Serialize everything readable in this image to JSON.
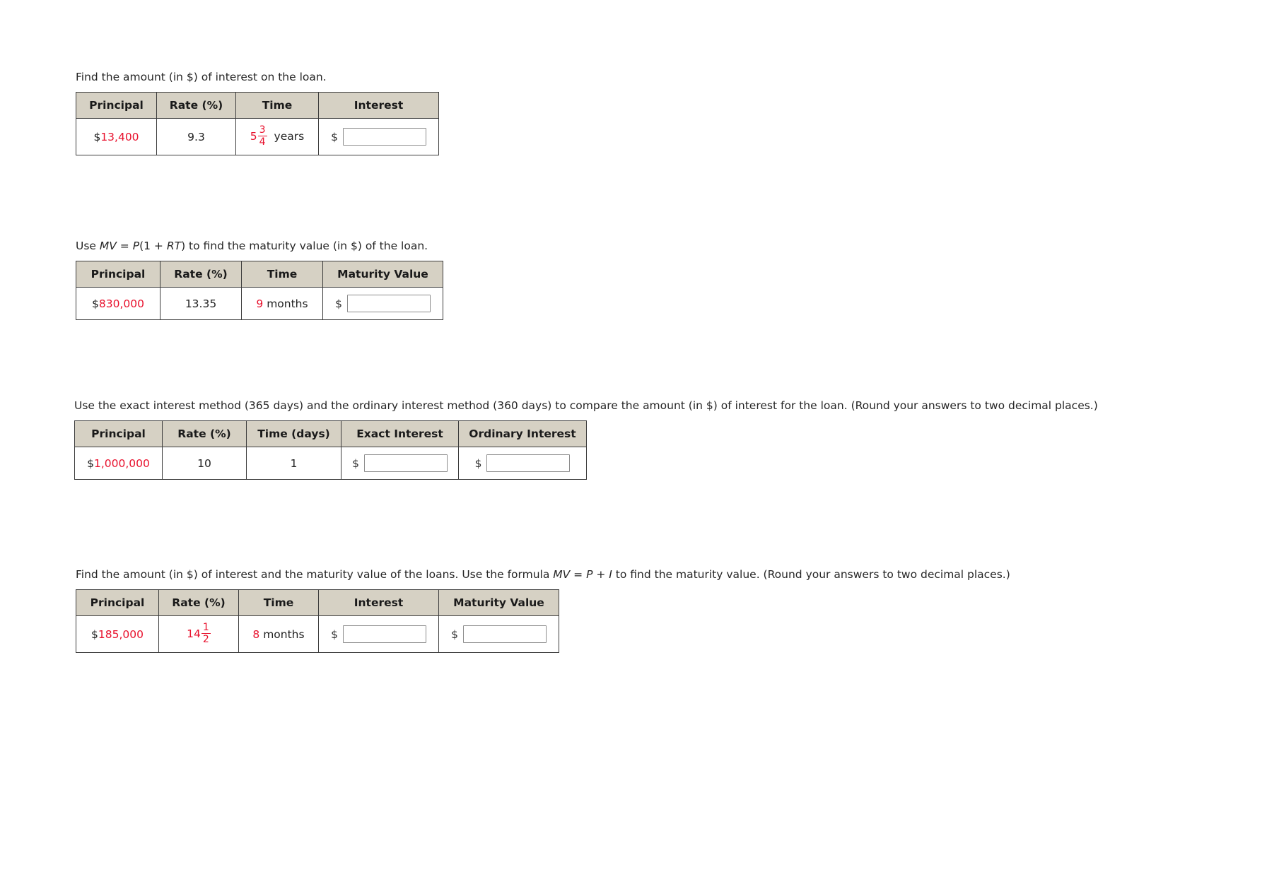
{
  "colors": {
    "highlight": "#e8112d",
    "header_bg": "#d6d1c4",
    "border": "#3c3c3c",
    "text": "#262626"
  },
  "problems": [
    {
      "id": "interest-on-loan",
      "prompt": {
        "parts": [
          {
            "text": "Find the amount (in $) of interest on the loan.",
            "italic": false
          }
        ]
      },
      "headers": [
        "Principal",
        "Rate (%)",
        "Time",
        "Interest"
      ],
      "row": {
        "principal": {
          "symbol": "$",
          "value": "13,400"
        },
        "rate": "9.3",
        "time": {
          "whole": "5",
          "numerator": "3",
          "denominator": "4",
          "unit": "years"
        },
        "answers": [
          {
            "label": "Interest",
            "prefix": "$",
            "value": "",
            "placeholder": ""
          }
        ]
      }
    },
    {
      "id": "maturity-value",
      "prompt": {
        "parts": [
          {
            "text": "Use ",
            "italic": false
          },
          {
            "text": "MV",
            "italic": true
          },
          {
            "text": " = ",
            "italic": false
          },
          {
            "text": "P",
            "italic": true
          },
          {
            "text": "(1 + ",
            "italic": false
          },
          {
            "text": "RT",
            "italic": true
          },
          {
            "text": ") to find the maturity value (in $) of the loan.",
            "italic": false
          }
        ]
      },
      "headers": [
        "Principal",
        "Rate (%)",
        "Time",
        "Maturity Value"
      ],
      "row": {
        "principal": {
          "symbol": "$",
          "value": "830,000"
        },
        "rate": "13.35",
        "time": {
          "number": "9",
          "unit": "months"
        },
        "answers": [
          {
            "label": "Maturity Value",
            "prefix": "$",
            "value": "",
            "placeholder": ""
          }
        ]
      }
    },
    {
      "id": "exact-vs-ordinary-interest",
      "prompt": {
        "parts": [
          {
            "text": "Use the exact interest method (365 days) and the ordinary interest method (360 days) to compare the amount (in $) of interest for the loan. (Round your answers to two decimal places.)",
            "italic": false
          }
        ]
      },
      "headers": [
        "Principal",
        "Rate (%)",
        "Time (days)",
        "Exact Interest",
        "Ordinary Interest"
      ],
      "row": {
        "principal": {
          "symbol": "$",
          "value": "1,000,000"
        },
        "rate": "10",
        "time": {
          "number": "1",
          "unit": ""
        },
        "answers": [
          {
            "label": "Exact Interest",
            "prefix": "$",
            "value": "",
            "placeholder": ""
          },
          {
            "label": "Ordinary Interest",
            "prefix": "$",
            "value": "",
            "placeholder": ""
          }
        ]
      }
    },
    {
      "id": "interest-and-maturity-value",
      "prompt": {
        "parts": [
          {
            "text": "Find the amount (in $) of interest and the maturity value of the loans. Use the formula ",
            "italic": false
          },
          {
            "text": "MV",
            "italic": true
          },
          {
            "text": " = ",
            "italic": false
          },
          {
            "text": "P",
            "italic": true
          },
          {
            "text": " + ",
            "italic": false
          },
          {
            "text": "I",
            "italic": true
          },
          {
            "text": " to find the maturity value. (Round your answers to two decimal places.)",
            "italic": false
          }
        ]
      },
      "headers": [
        "Principal",
        "Rate (%)",
        "Time",
        "Interest",
        "Maturity Value"
      ],
      "row": {
        "principal": {
          "symbol": "$",
          "value": "185,000"
        },
        "rate": {
          "whole": "14",
          "numerator": "1",
          "denominator": "2"
        },
        "time": {
          "number": "8",
          "unit": "months"
        },
        "answers": [
          {
            "label": "Interest",
            "prefix": "$",
            "value": "",
            "placeholder": ""
          },
          {
            "label": "Maturity Value",
            "prefix": "$",
            "value": "",
            "placeholder": ""
          }
        ]
      }
    }
  ]
}
